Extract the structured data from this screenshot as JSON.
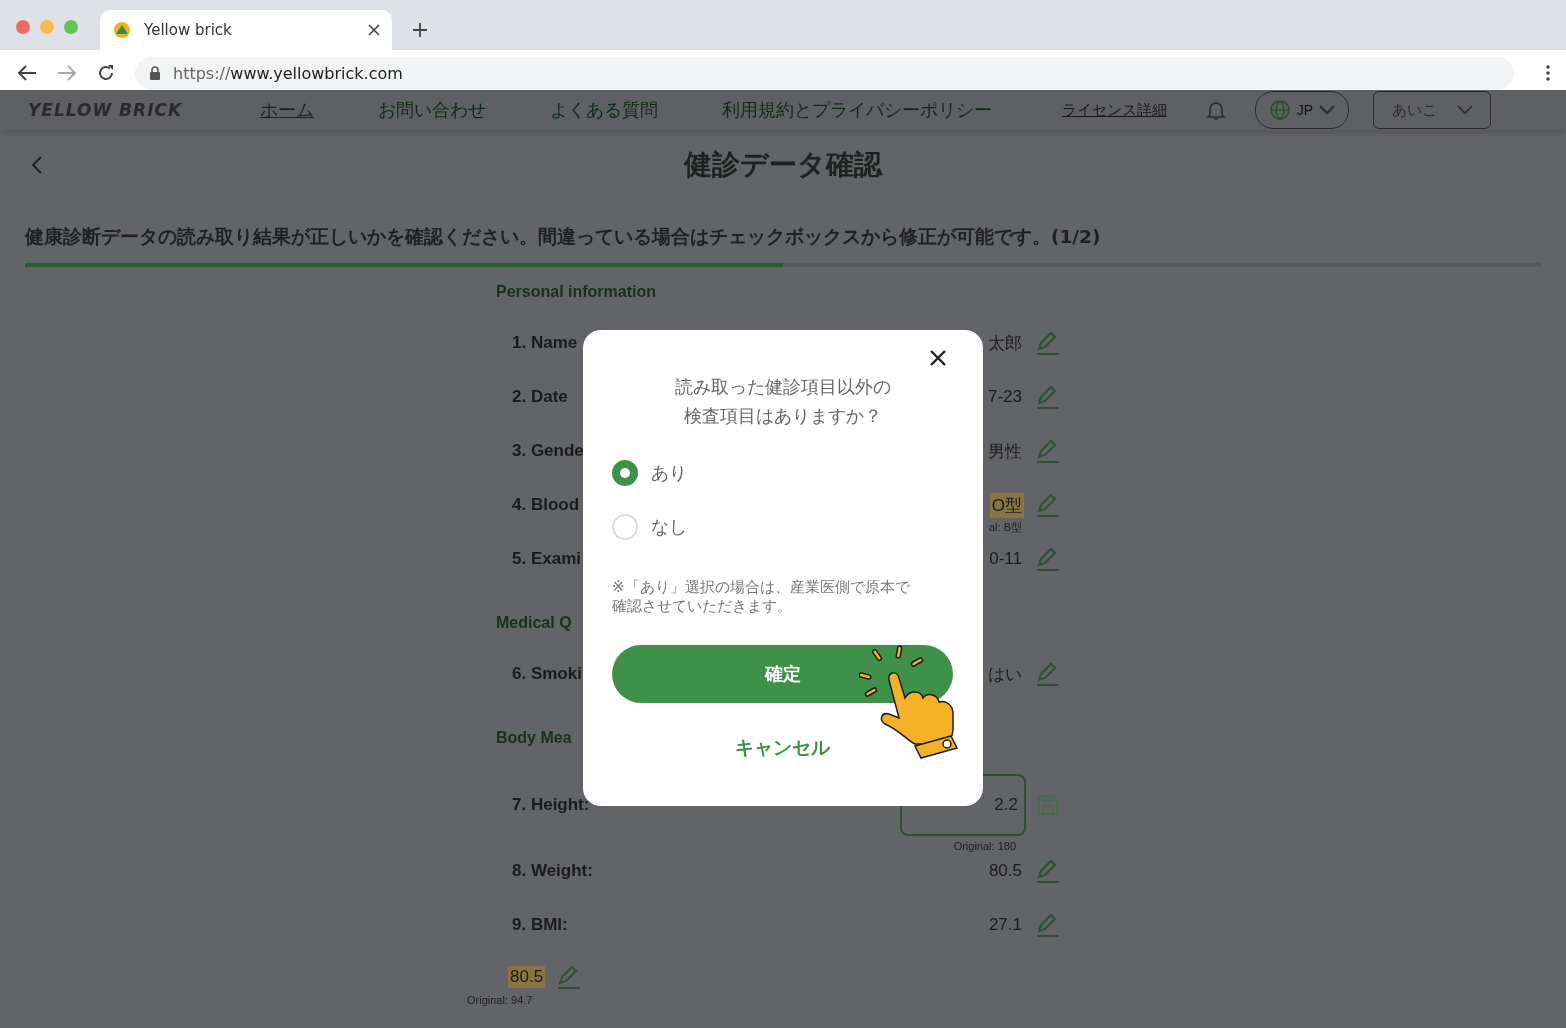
{
  "browser": {
    "tab_title": "Yellow brick",
    "url_scheme": "https://",
    "url_host": "www.yellowbrick.com"
  },
  "nav": {
    "logo": "YELLOW BRICK",
    "links": [
      {
        "label": "ホーム",
        "selected": true
      },
      {
        "label": "お問い合わせ",
        "selected": false
      },
      {
        "label": "よくある質問",
        "selected": false
      },
      {
        "label": "利用規約とプライバシーポリシー",
        "selected": false
      }
    ],
    "license_link": "ライセンス詳細",
    "language": "JP",
    "user": "あいこ"
  },
  "page": {
    "title": "健診データ確認",
    "instruction": "健康診断データの読み取り結果が正しいかを確認ください。間違っている場合はチェックボックスから修正が可能です。(1/2)",
    "progress": {
      "level": 0.5
    }
  },
  "sections": [
    {
      "title": "Personal information",
      "rows": [
        {
          "kind": "text",
          "label": "1. Name",
          "value": "太郎",
          "highlighted": false
        },
        {
          "kind": "text",
          "label": "2. Date",
          "value": "7-23",
          "highlighted": false
        },
        {
          "kind": "text",
          "label": "3. Gende",
          "value": "男性",
          "highlighted": false
        },
        {
          "kind": "text",
          "label": "4. Blood",
          "value": "O型",
          "highlighted": true,
          "original": "al: B型"
        },
        {
          "kind": "text",
          "label": "5. Exami",
          "value": "0-11",
          "highlighted": false
        }
      ]
    },
    {
      "title": "Medical Q",
      "rows": [
        {
          "kind": "text",
          "label": "6. Smoki",
          "value": "はい",
          "highlighted": false
        }
      ]
    },
    {
      "title": "Body Mea",
      "rows": [
        {
          "kind": "input",
          "label": "7. Height:",
          "value": "2.2",
          "highlighted": false,
          "original": "Original: 180"
        },
        {
          "kind": "text",
          "label": "8. Weight:",
          "value": "80.5",
          "highlighted": false
        },
        {
          "kind": "text",
          "label": "9. BMI:",
          "value": "27.1",
          "highlighted": false
        }
      ]
    }
  ],
  "extra": {
    "value": "80.5",
    "highlighted": true,
    "original": "Original: 94.7"
  },
  "modal": {
    "question": [
      "読み取った健診項目以外の",
      "検査項目はありますか？"
    ],
    "options": [
      {
        "label": "あり",
        "selected": true
      },
      {
        "label": "なし",
        "selected": false
      }
    ],
    "note": "※「あり」選択の場合は、産業医側で原本で確認させていただきます。",
    "confirm": "確定",
    "cancel": "キャンセル"
  }
}
